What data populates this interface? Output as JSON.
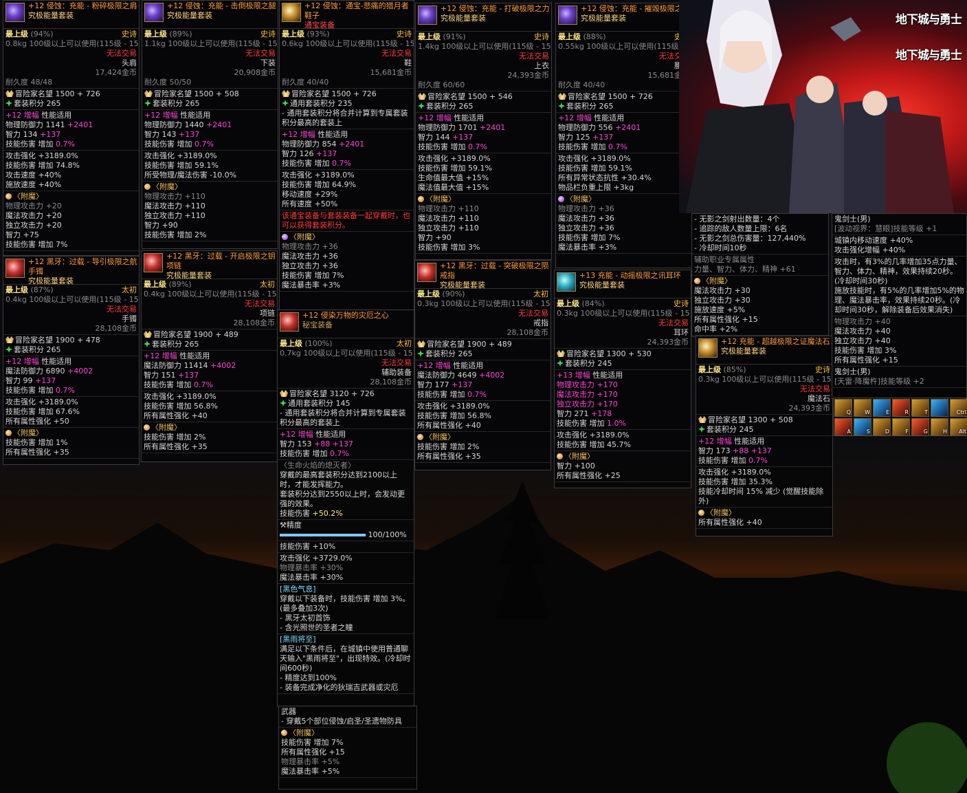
{
  "colors": {
    "epic": "#ffbf3a",
    "name": "#ff9a3c",
    "untradeable": "#ff3a3a",
    "amplify": "#ff44d8",
    "set_point": "#7cff5c"
  },
  "common": {
    "top": "最上级",
    "epic": "史诗",
    "untradeable": "无法交易",
    "enchant": "〈附魔〉",
    "fame": "冒险家名望",
    "set_points": "套装积分",
    "amp": "增幅",
    "amp_note": "性能适用",
    "set_gen": "通用套装积分"
  },
  "p1": {
    "name": "+12 侵蚀：充能 - 粉碎极限之肩",
    "set": "究极能量套装",
    "grade": "(94%)",
    "req": "0.8kg  100级以上可以使用(115级 - 15)",
    "slot": "头肩",
    "price": "17,424金币",
    "dura": "耐久度 48/48",
    "fame": "1500 + 726",
    "sp": "265",
    "amp": "+12",
    "s1": "物理防御力 1141",
    "s1b": "+2401",
    "s2": "智力 134",
    "s2b": "+137",
    "s3": "技能伤害 增加",
    "s3b": "0.7%",
    "e1": "攻击强化 +3189.0%",
    "e2": "技能伤害 增加 74.8%",
    "e3": "攻击速度 +40%",
    "e4": "施放速度 +40%",
    "en1": "物理攻击力 +20",
    "en2": "魔法攻击力 +20",
    "en3": "独立攻击力 +20",
    "en4": "智力 +75",
    "en5": "技能伤害 增加 7%"
  },
  "p2": {
    "name": "+12 侵蚀：充能 - 击倒极限之腿",
    "set": "究极能量套装",
    "grade": "(89%)",
    "req": "1.1kg  100级以上可以使用(115级 - 15)",
    "slot": "下装",
    "price": "20,908金币",
    "dura": "耐久度 50/50",
    "fame": "1500 + 508",
    "sp": "265",
    "amp": "+12",
    "s1": "物理防御力 1440",
    "s1b": "+2401",
    "s2": "智力 143",
    "s2b": "+137",
    "s3": "技能伤害 增加",
    "s3b": "0.7%",
    "e1": "攻击强化 +3189.0%",
    "e2": "技能伤害 增加 59.1%",
    "e3": "所受物理/魔法伤害 -10.0%",
    "en1": "物理攻击力 +110",
    "en2": "魔法攻击力 +110",
    "en3": "独立攻击力 +110",
    "en4": "智力 +90",
    "en5": "技能伤害 增加 2%"
  },
  "p3": {
    "name": "+12 侵蚀：通宝-悲痛的猎月者鞋子",
    "set": "通宝装备",
    "grade": "(93%)",
    "req": "0.6kg  100级以上可以使用(115级 - 15)",
    "slot": "鞋",
    "price": "15,681金币",
    "dura": "耐久度 40/40",
    "fame": "1500 + 726",
    "sp": "235",
    "note": "- 通用套装积分将合并计算到专属套装积分最高的套装上",
    "amp": "+12",
    "s1": "物理防御力 854",
    "s1b": "+2401",
    "s2": "智力 126",
    "s2b": "+137",
    "s3": "技能伤害 增加",
    "s3b": "0.7%",
    "e1": "攻击强化 +3189.0%",
    "e2": "技能伤害 增加 64.9%",
    "e3": "移动速度 +29%",
    "e4": "所有速度 +50%",
    "warn": "该通宝装备与套装装备一起穿戴时，也可以获得套装积分。",
    "en1": "物理攻击力 +36",
    "en2": "魔法攻击力 +36",
    "en3": "独立攻击力 +36",
    "en4": "技能伤害 增加 7%",
    "en5": "魔法暴击率 +3%"
  },
  "p4": {
    "name": "+12 侵蚀：充能 - 打破极限之力",
    "set": "究极能量套装",
    "grade": "(91%)",
    "req": "1.4kg  100级以上可以使用(115级 - 15)",
    "slot": "上衣",
    "price": "24,393金币",
    "dura": "耐久度 60/60",
    "fame": "1500 + 546",
    "sp": "265",
    "amp": "+12",
    "s1": "物理防御力 1701",
    "s1b": "+2401",
    "s2": "智力 144",
    "s2b": "+137",
    "s3": "技能伤害 增加",
    "s3b": "0.7%",
    "e1": "攻击强化 +3189.0%",
    "e2": "技能伤害 增加 59.1%",
    "e3": "生命值最大值 +15%",
    "e4": "魔法值最大值 +15%",
    "en1": "物理攻击力 +110",
    "en2": "魔法攻击力 +110",
    "en3": "独立攻击力 +110",
    "en4": "智力 +90",
    "en5": "技能伤害 增加 3%"
  },
  "p5": {
    "name": "+12 侵蚀：充能 - 摧毁极限之腰",
    "set": "究极能量套装",
    "grade": "(88%)",
    "req": "0.55kg  100级以上可以使用(115级 - 15)",
    "slot": "腰带",
    "price": "15,681金币",
    "dura": "耐久度 40/40",
    "fame": "1500 + 726",
    "sp": "265",
    "amp": "+12",
    "s1": "物理防御力 556",
    "s1b": "+2401",
    "s2": "智力 125",
    "s2b": "+137",
    "s3": "技能伤害 增加",
    "s3b": "0.7%",
    "e1": "攻击强化 +3189.0%",
    "e2": "技能伤害 增加 59.1%",
    "e3": "所有异常状态抗性 +30.4%",
    "e4": "物品栏负重上限 +3kg",
    "en1": "物理攻击力 +36",
    "en2": "魔法攻击力 +36",
    "en3": "独立攻击力 +36",
    "en4": "技能伤害 增加 7%",
    "en5": "魔法暴击率 +3%"
  },
  "p6": {
    "name": "+12 黑牙：过载 - 导引极限之航手镯",
    "set": "究极能量套装",
    "grade": "(87%)",
    "origin": "太初",
    "req": "0.4kg  100级以上可以使用(115级 - 15)",
    "slot": "手镯",
    "price": "28,108金币",
    "fame": "1900 + 478",
    "sp": "265",
    "amp": "+12",
    "s1": "魔法防御力 6890",
    "s1b": "+4002",
    "s2": "智力 99",
    "s2b": "+137",
    "s3": "技能伤害 增加",
    "s3b": "0.7%",
    "e1": "攻击强化 +3189.0%",
    "e2": "技能伤害 增加 67.6%",
    "e3": "所有属性强化 +50",
    "en1": "技能伤害 增加 1%",
    "en2": "所有属性强化 +35"
  },
  "p7": {
    "name": "+12 黑牙：过载 - 开启极限之钥项链",
    "set": "究极能量套装",
    "grade": "(89%)",
    "origin": "太初",
    "req": "0.4kg  100级以上可以使用(115级 - 15)",
    "slot": "项链",
    "price": "28,108金币",
    "fame": "1900 + 489",
    "sp": "265",
    "amp": "+12",
    "s1": "魔法防御力 11414",
    "s1b": "+4002",
    "s2": "智力 151",
    "s2b": "+137",
    "s3": "技能伤害 增加",
    "s3b": "0.7%",
    "e1": "攻击强化 +3189.0%",
    "e2": "技能伤害 增加 56.8%",
    "e3": "所有属性强化 +40",
    "en1": "技能伤害 增加 2%",
    "en2": "所有属性强化 +35"
  },
  "p8": {
    "name": "+12 侵染万物的灾厄之心",
    "set": "秘宝装备",
    "grade": "(100%)",
    "origin": "太初",
    "req": "0.7kg  100级以上可以使用(115级 - 15)",
    "slot": "辅助装备",
    "price": "28,108金币",
    "fame": "3120 + 726",
    "sp": "145",
    "note": "- 通用套装积分将合并计算到专属套装积分最高的套装上",
    "amp": "+12",
    "s2": "智力 153",
    "s2b": "+88 +137",
    "s3": "技能伤害 增加",
    "s3b": "0.7%",
    "life": "〈生命火焰的熄灭者〉",
    "life1": "穿戴的最高套装积分达到2100以上时，才能发挥能力。",
    "life2": "套装积分达到2550以上时，会发动更强的效果。",
    "life3": "技能伤害",
    "life3b": "+50.2%",
    "prec": "精度",
    "precv": "100/100%",
    "precfill": 1.0,
    "p1": "技能伤害 +10%",
    "e1": "攻击强化 +3729.0%",
    "e2": "物理暴击率 +30%",
    "e3": "魔法暴击率 +30%",
    "b1": "[黑色气息]",
    "b2": "穿戴以下装备时，技能伤害 增加 3%。(最多叠加3次)",
    "b3": "- 黑牙太初首饰",
    "b4": "- 含光照世的圣者之瞳",
    "r1": "[黑雨将至]",
    "r2": "满足以下条件后，在城镇中使用普通聊天输入\"黑雨将至\"，出现特效。(冷却时间600秒)",
    "r3": "- 精度达到100%",
    "r4": "- 装备完成净化的狄瑞吉武器或灾厄",
    "w1": "武器",
    "w2": "- 穿戴5个部位侵蚀/启圣/圣遗物防具",
    "en1": "技能伤害 增加 7%",
    "en2": "所有属性强化 +15",
    "en3": "物理暴击率 +5%",
    "en4": "魔法暴击率 +5%"
  },
  "p9": {
    "name": "+12 黑牙：过载 - 突破极限之陨戒指",
    "set": "究极能量套装",
    "grade": "(90%)",
    "origin": "太初",
    "req": "0.3kg  100级以上可以使用(115级 - 15)",
    "slot": "戒指",
    "price": "28,108金币",
    "fame": "1900 + 489",
    "sp": "265",
    "amp": "+12",
    "s1": "魔法防御力 4649",
    "s1b": "+4002",
    "s2": "智力 177",
    "s2b": "+137",
    "s3": "技能伤害 增加",
    "s3b": "0.7%",
    "e1": "攻击强化 +3189.0%",
    "e2": "技能伤害 增加 56.8%",
    "e3": "所有属性强化 +40",
    "en1": "技能伤害 增加 2%",
    "en2": "所有属性强化 +35"
  },
  "p10": {
    "name": "+13 充能 - 动摇极限之讯耳环",
    "set": "究极能量套装",
    "grade": "(84%)",
    "req": "0.3kg  100级以上可以使用(115级 - 15)",
    "slot": "耳环",
    "price": "24,393金币",
    "fame": "1300 + 530",
    "sp": "245",
    "amp": "+13",
    "s1": "物理攻击力 +170",
    "s1b": "魔法攻击力 +170",
    "s1c": "独立攻击力 +170",
    "s2": "智力 271",
    "s2b": "+178",
    "s3": "技能伤害 增加",
    "s3b": "1.0%",
    "e1": "攻击强化 +3189.0%",
    "e2": "技能伤害 增加 45.7%",
    "en1": "智力 +100",
    "en2": "所有属性强化 +25"
  },
  "p11": {
    "name": "+12 充能 - 超越极限之证魔法石",
    "set": "究极能量套装",
    "grade": "(85%)",
    "req": "0.3kg  100级以上可以使用(115级 - 15)",
    "slot": "魔法石",
    "price": "24,393金币",
    "fame": "1300 + 508",
    "sp": "245",
    "amp": "+12",
    "s2": "智力 173",
    "s2b": "+88 +137",
    "s3": "技能伤害 增加",
    "s3b": "0.7%",
    "e1": "攻击强化 +3189.0%",
    "e2": "技能伤害 增加 35.3%",
    "e3": "技能冷却时间 15% 减少 (觉醒技能除外)",
    "en1": "所有属性强化 +40"
  },
  "p12": {
    "l1": "- 无影之剑射出数量：4个",
    "l2": "- 追踪的敌人数量上限：6名",
    "l3": "- 无影之剑总伤害量：127,440%",
    "l4": "- 冷却时间10秒",
    "sub": "辅助职业专属属性",
    "subv": "力量、智力、体力、精神 +61",
    "en1": "魔法攻击力 +30",
    "en2": "独立攻击力 +30",
    "en3": "施放速度 +5%",
    "en4": "所有属性强化 +15",
    "en5": "命中率 +2%"
  },
  "p13": {
    "t1": "鬼剑士(男)",
    "t2": "[波动视界：慧眼]技能等级 +1",
    "t3": "城镇内移动速度 +40%",
    "t4": "攻击强化增幅 +40%",
    "t5": "攻击时，有3%的几率增加35点力量、智力、体力、精神，效果持续20秒。(冷却时间30秒)",
    "t6": "施放技能时，有5%的几率增加5%的物理、魔法暴击率，效果持续20秒。(冷却时间30秒，解除装备后效果消失)",
    "en0": "物理攻击力 +40",
    "en1": "魔法攻击力 +40",
    "en2": "独立攻击力 +40",
    "en3": "技能伤害 增加 3%",
    "en4": "所有属性强化 +15",
    "t7": "鬼剑士(男)",
    "t8": "[天雷·降魔杵]技能等级 +2"
  },
  "art": {
    "logo": "地下城与勇士"
  },
  "skills": [
    "Q",
    "W",
    "E",
    "R",
    "T",
    "",
    "Ctrl",
    "A",
    "S",
    "D",
    "F",
    "G",
    "H",
    "Alt"
  ]
}
